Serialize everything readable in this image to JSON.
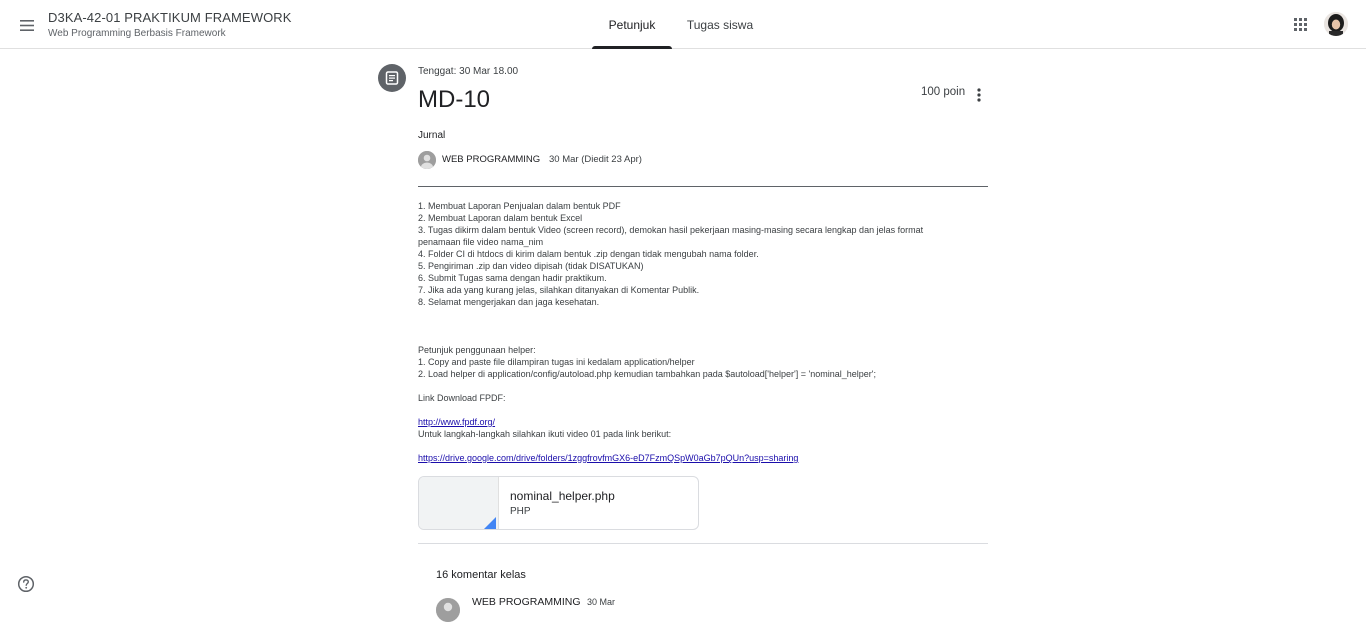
{
  "header": {
    "class_title": "D3KA-42-01 PRAKTIKUM FRAMEWORK",
    "class_subtitle": "Web Programming Berbasis Framework",
    "tabs": [
      {
        "label": "Petunjuk",
        "active": true
      },
      {
        "label": "Tugas siswa",
        "active": false
      }
    ],
    "menu_icon": "hamburger-menu-icon",
    "apps_icon": "apps-grid-icon",
    "avatar_icon": "user-avatar"
  },
  "assignment": {
    "icon": "assignment-icon",
    "due": "Tenggat: 30 Mar 18.00",
    "title": "MD-10",
    "points": "100 poin",
    "topic": "Jurnal",
    "author": "WEB PROGRAMMING",
    "posted": "30 Mar (Diedit 23 Apr)",
    "instructions": [
      "1. Membuat Laporan Penjualan dalam bentuk PDF",
      "2. Membuat Laporan dalam bentuk Excel",
      "3. Tugas dikirm dalam bentuk Video (screen record), demokan hasil pekerjaan masing-masing secara lengkap dan jelas format penamaan file video nama_nim",
      "4. Folder CI di htdocs di kirim dalam bentuk .zip dengan tidak mengubah nama folder.",
      "5. Pengiriman .zip dan video dipisah (tidak DISATUKAN)",
      "6. Submit Tugas sama dengan hadir praktikum.",
      "7. Jika ada yang kurang jelas, silahkan ditanyakan di Komentar Publik.",
      "8. Selamat mengerjakan dan jaga kesehatan."
    ],
    "helper_heading": "Petunjuk penggunaan helper:",
    "helper_steps": [
      "1. Copy and paste file dilampiran tugas ini kedalam application/helper",
      "2. Load helper di application/config/autoload.php kemudian tambahkan pada $autoload['helper'] = 'nominal_helper';"
    ],
    "fpdf_label": "Link Download FPDF:",
    "fpdf_link": "http://www.fpdf.org/",
    "video_label": "Untuk langkah-langkah silahkan ikuti video 01 pada link berikut:",
    "video_link": "https://drive.google.com/drive/folders/1zggfrovfmGX6-eD7FzmQSpW0aGb7pQUn?usp=sharing"
  },
  "attachment": {
    "name": "nominal_helper.php",
    "type": "PHP",
    "accent": "#4285f4"
  },
  "comments": {
    "count_label": "16 komentar kelas",
    "first_author": "WEB PROGRAMMING",
    "first_date": "30 Mar"
  },
  "colors": {
    "tab_indicator": "#202124",
    "link": "#1a0dab",
    "icon_gray": "#5f6368"
  }
}
